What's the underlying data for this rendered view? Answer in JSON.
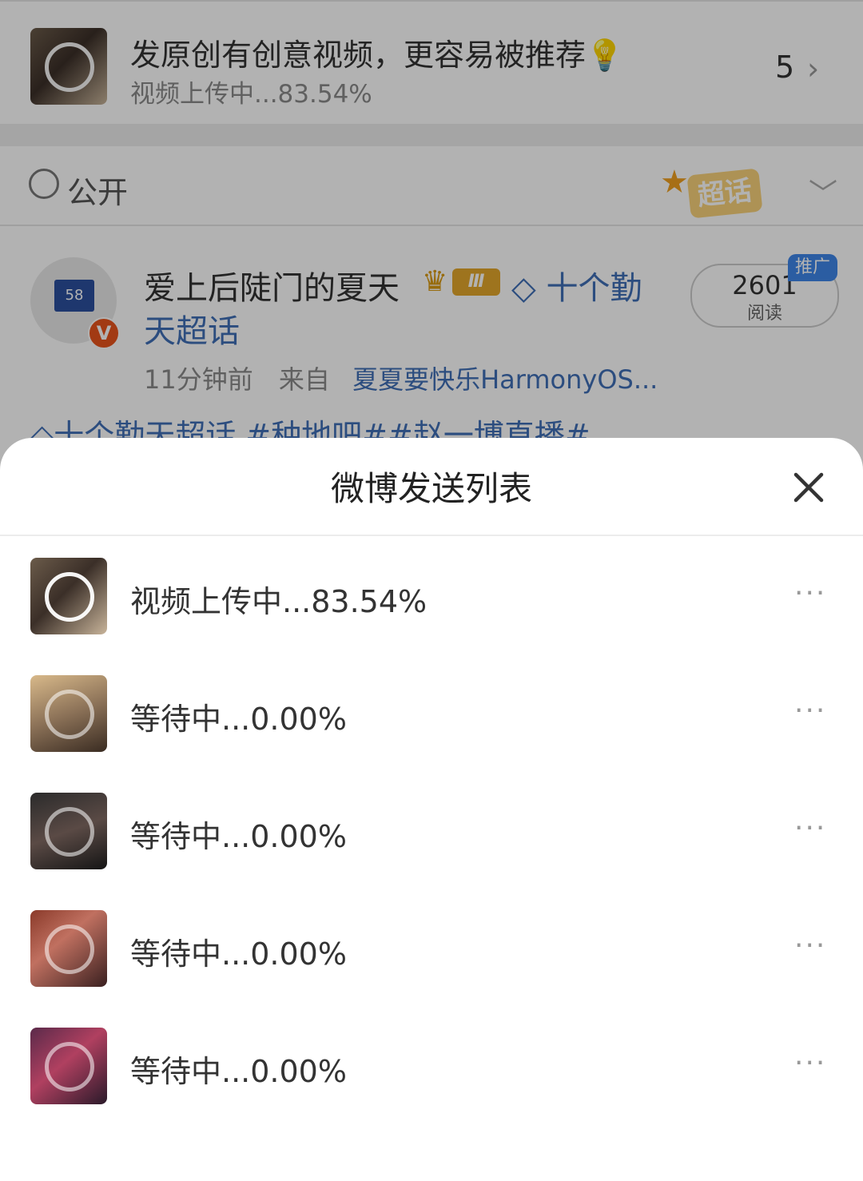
{
  "background": {
    "upload_bar": {
      "title": "发原创有创意视频，更容易被推荐💡",
      "subtitle": "视频上传中...83.54%",
      "count": "5",
      "chevron": "›"
    },
    "visibility": {
      "icon": "globe-icon",
      "label": "公开",
      "super_topic_badge": "超话"
    },
    "post": {
      "avatar_sign": "58",
      "verified_badge": "V",
      "user_name": "爱上后陡门的夏天",
      "level": "Ⅲ",
      "topic_line1": "◇ 十个勤",
      "topic_line2": "天超话",
      "time": "11分钟前",
      "source_prefix": "来自",
      "source": "夏夏要快乐HarmonyOS...",
      "reads_count": "2601",
      "reads_label": "阅读",
      "promo_badge": "推广",
      "tags": "◇十个勤天超话 #种地吧##赵一博直播#"
    }
  },
  "sheet": {
    "title": "微博发送列表",
    "close_icon": "close-icon",
    "items": [
      {
        "status": "视频上传中...83.54%",
        "more": "···"
      },
      {
        "status": "等待中...0.00%",
        "more": "···"
      },
      {
        "status": "等待中...0.00%",
        "more": "···"
      },
      {
        "status": "等待中...0.00%",
        "more": "···"
      },
      {
        "status": "等待中...0.00%",
        "more": "···"
      }
    ]
  },
  "colors": {
    "link_blue": "#3f6fb6",
    "overlay": "rgba(0,0,0,0.30)",
    "badge_orange": "#e8531c",
    "promo_blue": "#3e86e8"
  }
}
